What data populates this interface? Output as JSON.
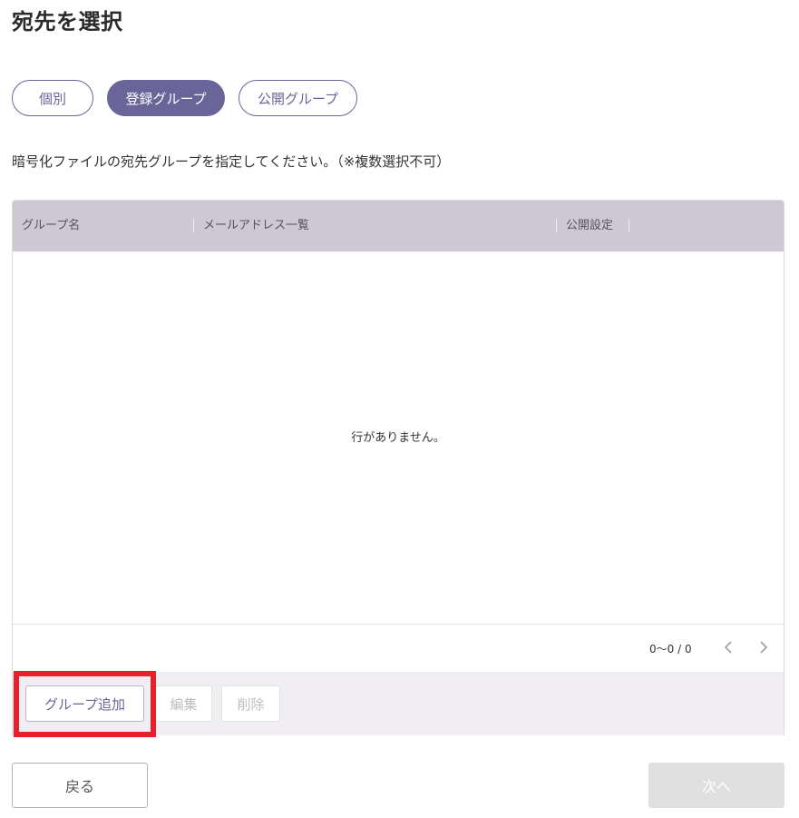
{
  "page": {
    "title": "宛先を選択"
  },
  "tabs": [
    {
      "label": "個別",
      "active": false
    },
    {
      "label": "登録グループ",
      "active": true
    },
    {
      "label": "公開グループ",
      "active": false
    }
  ],
  "instruction": "暗号化ファイルの宛先グループを指定してください。（※複数選択不可）",
  "grid": {
    "columns": [
      "グループ名",
      "メールアドレス一覧",
      "公開設定"
    ],
    "rows": [],
    "empty_message": "行がありません。",
    "pagination": {
      "info": "0〜0 / 0",
      "prev_icon": "chevron-left-icon",
      "next_icon": "chevron-right-icon"
    }
  },
  "actions": {
    "add_label": "グループ追加",
    "edit_label": "編集",
    "delete_label": "削除"
  },
  "footer": {
    "back_label": "戻る",
    "next_label": "次へ"
  },
  "colors": {
    "accent": "#6a6598",
    "header_bg": "#cdc8d4",
    "action_bar_bg": "#f0eef3",
    "highlight": "#e8202a",
    "disabled_bg": "#e0e0e0"
  }
}
